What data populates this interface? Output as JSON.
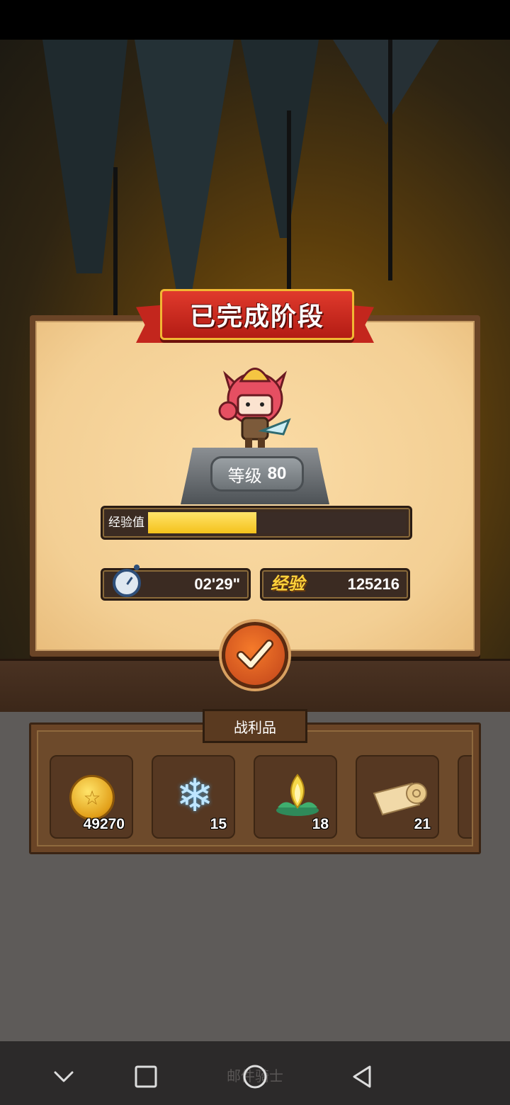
{
  "dialog": {
    "title": "已完成阶段"
  },
  "hero": {
    "level_label": "等级",
    "level_value": "80"
  },
  "experience": {
    "bar_label": "经验值",
    "progress": 0.42
  },
  "stats": {
    "time": "02'29\"",
    "exp_tag": "经验",
    "exp_value": "125216"
  },
  "confirm": {
    "icon": "check-icon"
  },
  "loot": {
    "title": "战利品",
    "items": [
      {
        "icon": "gold-coin-icon",
        "count": "49270"
      },
      {
        "icon": "snowflake-icon",
        "count": "15"
      },
      {
        "icon": "lotus-icon",
        "count": "18"
      },
      {
        "icon": "scroll-icon",
        "count": "21"
      }
    ]
  },
  "navbar": {
    "ghost_text": "邮件骑士",
    "buttons": [
      "chevron-down-icon",
      "square-icon",
      "circle-icon",
      "back-triangle-icon"
    ]
  },
  "colors": {
    "ribbon": "#c3261d",
    "exp_fill": "#f4c21b",
    "panel_paper": "#f3cf94",
    "confirm": "#e05f22"
  }
}
